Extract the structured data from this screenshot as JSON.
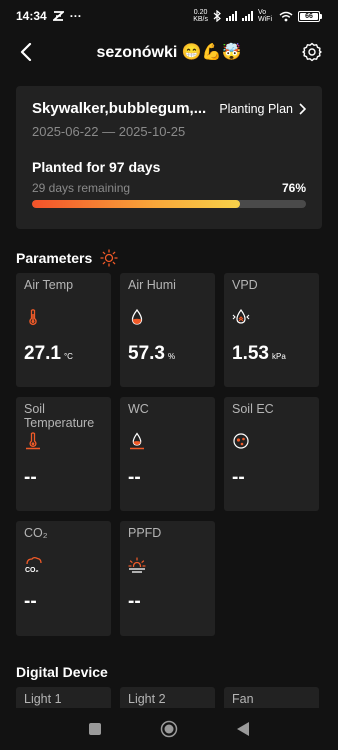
{
  "status_bar": {
    "time": "14:34",
    "speed_value": "0.20",
    "speed_unit": "KB/s",
    "vowifi": "Vo WiFi",
    "battery": "66"
  },
  "header": {
    "title": "sezonówki 😁💪🤯"
  },
  "plan": {
    "name": "Skywalker,bubblegum,...",
    "link_label": "Planting Plan",
    "dates": "2025-06-22 — 2025-10-25",
    "planted_text": "Planted for 97 days",
    "remaining_text": "29 days remaining",
    "progress_label": "76%",
    "progress_fraction": 0.76
  },
  "parameters": {
    "title": "Parameters",
    "tiles": [
      {
        "label": "Air Temp",
        "value": "27.1",
        "unit": "°C",
        "icon": "thermometer-icon"
      },
      {
        "label": "Air Humi",
        "value": "57.3",
        "unit": "%",
        "icon": "droplet-icon"
      },
      {
        "label": "VPD",
        "value": "1.53",
        "unit": "kPa",
        "icon": "vapor-droplet-icon"
      },
      {
        "label": "Soil Temperature",
        "value": "--",
        "unit": "",
        "icon": "soil-thermometer-icon"
      },
      {
        "label": "WC",
        "value": "--",
        "unit": "",
        "icon": "soil-water-icon"
      },
      {
        "label": "Soil EC",
        "value": "--",
        "unit": "",
        "icon": "soil-ec-icon"
      },
      {
        "label": "CO₂",
        "value": "--",
        "unit": "",
        "icon": "co2-icon"
      },
      {
        "label": "PPFD",
        "value": "--",
        "unit": "",
        "icon": "sun-horizon-icon"
      }
    ]
  },
  "digital_device": {
    "title": "Digital Device",
    "tiles": [
      {
        "label": "Light 1"
      },
      {
        "label": "Light 2"
      },
      {
        "label": "Fan"
      }
    ]
  },
  "colors": {
    "accent": "#f05a28",
    "background": "#121212",
    "card": "#222222"
  }
}
